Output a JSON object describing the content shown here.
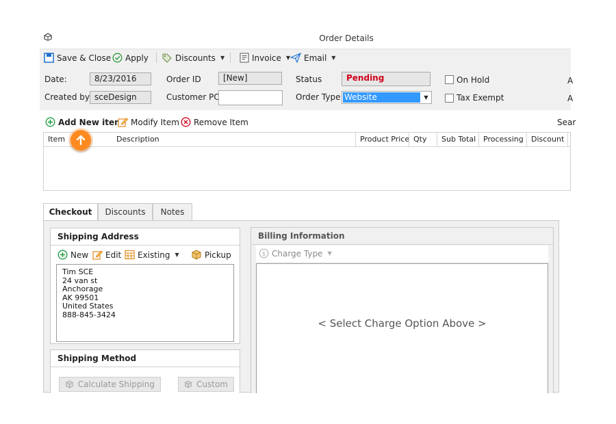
{
  "window": {
    "title": "Order Details"
  },
  "toolbar": {
    "save_close": "Save & Close",
    "apply": "Apply",
    "discounts": "Discounts",
    "invoice": "Invoice",
    "email": "Email"
  },
  "header": {
    "date_label": "Date:",
    "date_value": "8/23/2016",
    "created_by_label": "Created by",
    "created_by_value": "sceDesign",
    "order_id_label": "Order ID",
    "order_id_value": "[New]",
    "customer_po_label": "Customer PO",
    "customer_po_value": "",
    "status_label": "Status",
    "status_value": "Pending",
    "order_type_label": "Order Type",
    "order_type_value": "Website",
    "on_hold_label": "On Hold",
    "tax_exempt_label": "Tax Exempt",
    "cut_label_1": "A",
    "cut_label_2": "A"
  },
  "items_toolbar": {
    "add": "Add New item",
    "modify": "Modify Item",
    "remove": "Remove Item",
    "search_cut": "Sear"
  },
  "grid": {
    "columns": [
      "Item",
      "Description",
      "Product Price",
      "Qty",
      "Sub Total",
      "Processing",
      "Discount"
    ]
  },
  "tabs": [
    "Checkout",
    "Discounts",
    "Notes"
  ],
  "shipping_address": {
    "title": "Shipping Address",
    "new": "New",
    "edit": "Edit",
    "existing": "Existing",
    "pickup": "Pickup",
    "lines": [
      "Tim SCE",
      "24 van st",
      "Anchorage",
      "AK 99501",
      "United States",
      "888-845-3424"
    ]
  },
  "shipping_method": {
    "title": "Shipping Method",
    "calculate": "Calculate Shipping",
    "custom": "Custom"
  },
  "billing": {
    "title": "Billing Information",
    "charge_type": "Charge Type",
    "placeholder": "< Select Charge Option Above >"
  },
  "colors": {
    "accent": "#3399ff",
    "status": "#d0021b",
    "marker": "#ff8a1f",
    "add_green": "#1a9a3a",
    "remove_red": "#d0021b"
  }
}
